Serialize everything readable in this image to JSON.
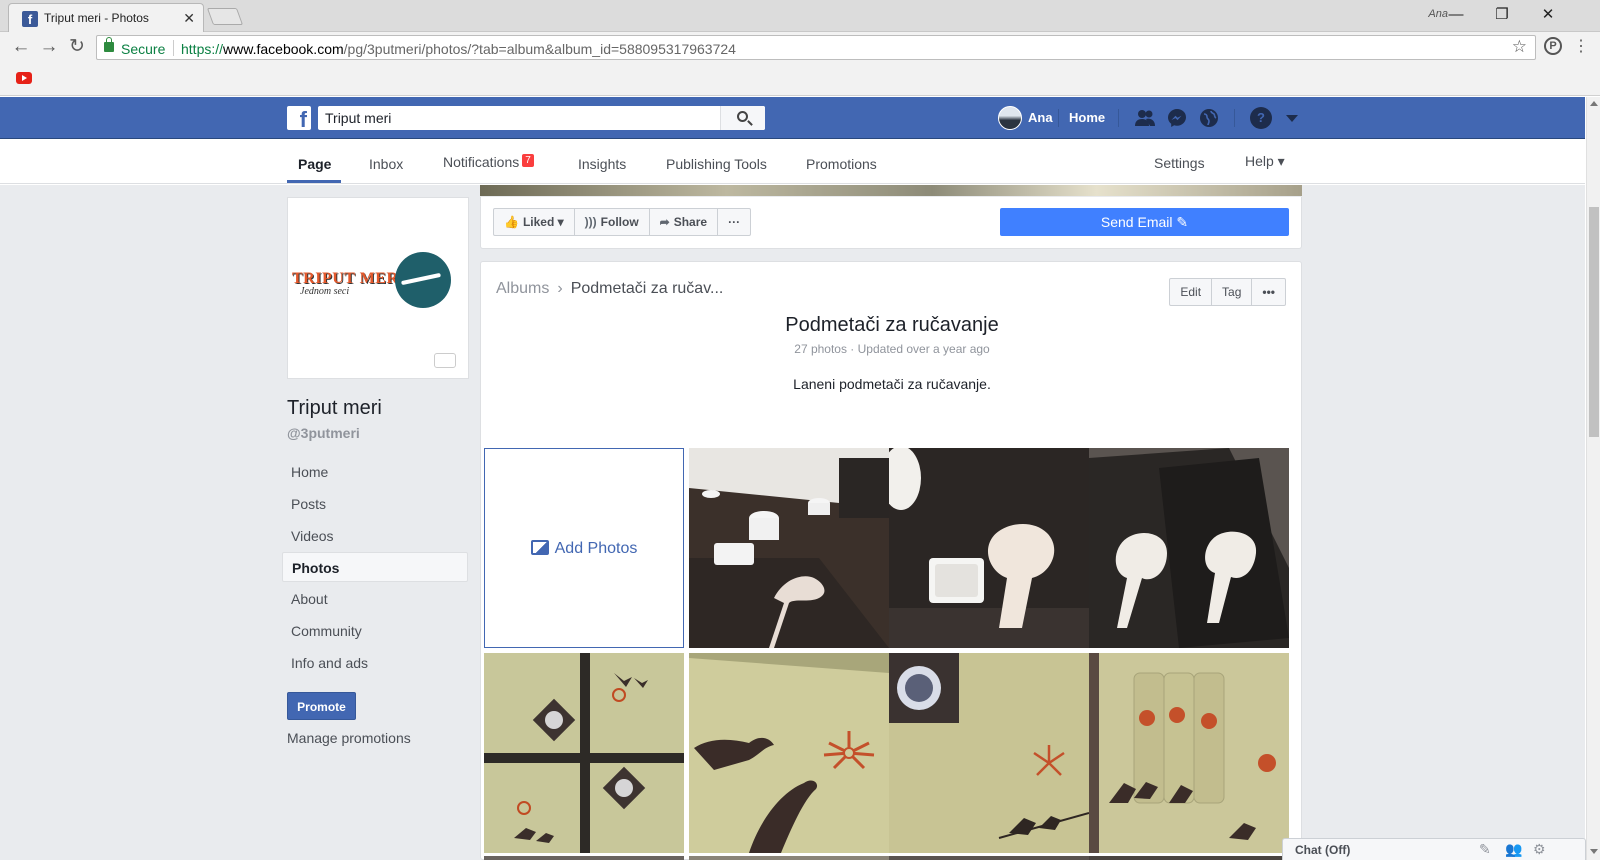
{
  "browser": {
    "tab_title": "Triput meri - Photos",
    "tab_close": "✕",
    "user_chip": "Ana",
    "win_minimize": "—",
    "win_restore": "❐",
    "win_close": "✕",
    "secure_label": "Secure",
    "url_proto": "https://",
    "url_host": "www.facebook.com",
    "url_path": "/pg/3putmeri/photos/?tab=album&album_id=588095317963724",
    "back": "←",
    "forward": "→",
    "reload": "↻",
    "star": "☆",
    "menu": "⋮"
  },
  "fb_bar": {
    "logo": "f",
    "search_value": "Triput meri",
    "user_name": "Ana",
    "home": "Home",
    "help": "?"
  },
  "page_tabs": {
    "page": "Page",
    "inbox": "Inbox",
    "notifications": "Notifications",
    "notifications_count": "7",
    "insights": "Insights",
    "publishing_tools": "Publishing Tools",
    "promotions": "Promotions",
    "settings": "Settings",
    "help": "Help ▾"
  },
  "profile": {
    "logo_text": "TRIPUT MERI",
    "logo_script": "Jednom seci",
    "name": "Triput meri",
    "handle": "@3putmeri"
  },
  "left_nav": [
    {
      "label": "Home"
    },
    {
      "label": "Posts"
    },
    {
      "label": "Videos"
    },
    {
      "label": "Photos",
      "active": true
    },
    {
      "label": "About"
    },
    {
      "label": "Community"
    },
    {
      "label": "Info and ads"
    }
  ],
  "promote": {
    "button": "Promote",
    "manage": "Manage promotions"
  },
  "actions": {
    "liked": "Liked ▾",
    "follow": "Follow",
    "share": "Share",
    "more": "···",
    "send_email": "Send Email ✎"
  },
  "album": {
    "crumb_albums": "Albums",
    "crumb_current": "Podmetači za ručav...",
    "edit": "Edit",
    "tag": "Tag",
    "more": "•••",
    "title": "Podmetači za ručavanje",
    "meta": "27 photos · Updated over a year ago",
    "description": "Laneni podmetači za ručavanje.",
    "add_photos": "Add Photos"
  },
  "chat": {
    "label": "Chat (Off)"
  },
  "colors": {
    "fb_blue": "#4267b2",
    "send_email_blue": "#4080ff",
    "notif_red": "#fa3e3e",
    "page_bg": "#e9ebee"
  }
}
